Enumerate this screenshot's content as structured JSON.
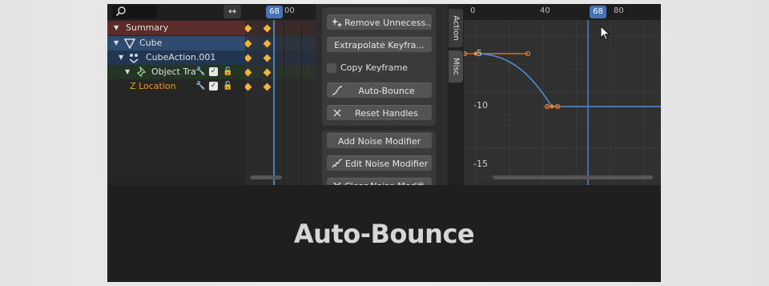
{
  "channels": {
    "summary": "Summary",
    "cube": "Cube",
    "action": "CubeAction.001",
    "object_transforms": "Object Tra",
    "z_location": "Z Location"
  },
  "dopesheet": {
    "current_frame": "68",
    "next_tick": "00"
  },
  "panel": {
    "remove_unnecessary": "Remove Unnecess...",
    "extrapolate": "Extrapolate Keyfra...",
    "copy_keyframe": "Copy Keyframe",
    "auto_bounce": "Auto-Bounce",
    "reset_handles": "Reset Handles",
    "add_noise": "Add Noise Modifier",
    "edit_noise": "Edit Noise Modifier",
    "clear_noise": "Clear Noise Modifi..."
  },
  "tabs": {
    "action": "Action",
    "misc": "Misc"
  },
  "graph": {
    "x_ticks": [
      "0",
      "40",
      "80"
    ],
    "current_frame": "68",
    "y_labels": [
      "-5",
      "-10",
      "-15"
    ]
  },
  "caption": "Auto-Bounce",
  "colors": {
    "accent_blue": "#4772b3",
    "keyframe": "#f2b33c",
    "curve": "#4b8fd6",
    "handle": "#e0843a"
  }
}
